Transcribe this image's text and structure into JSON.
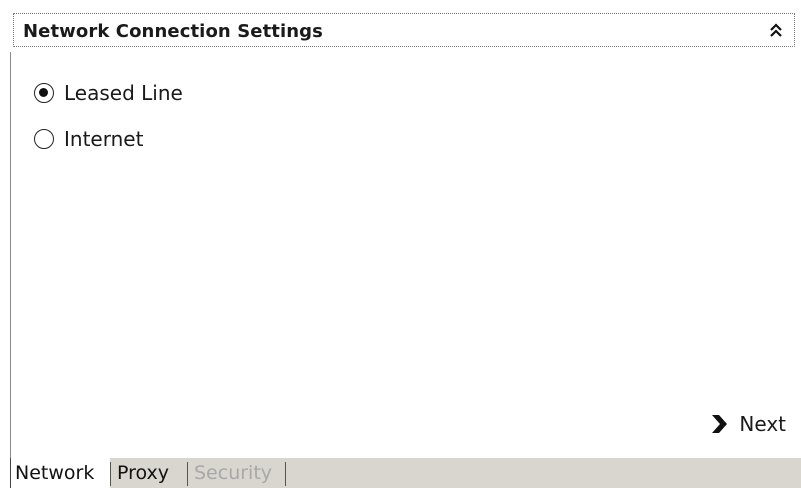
{
  "panel": {
    "title": "Network Connection Settings",
    "collapse_icon": "double-chevron-up-icon"
  },
  "connection_options": [
    {
      "label": "Leased Line",
      "selected": true
    },
    {
      "label": "Internet",
      "selected": false
    }
  ],
  "next_button": {
    "label": "Next",
    "icon": "chevron-right-icon"
  },
  "tabs": [
    {
      "label": "Network",
      "state": "active"
    },
    {
      "label": "Proxy",
      "state": "normal"
    },
    {
      "label": "Security",
      "state": "disabled"
    }
  ],
  "colors": {
    "tabbar_background": "#d9d6d0",
    "disabled_text": "#a8a8a8",
    "header_border": "#7a7a7a"
  }
}
